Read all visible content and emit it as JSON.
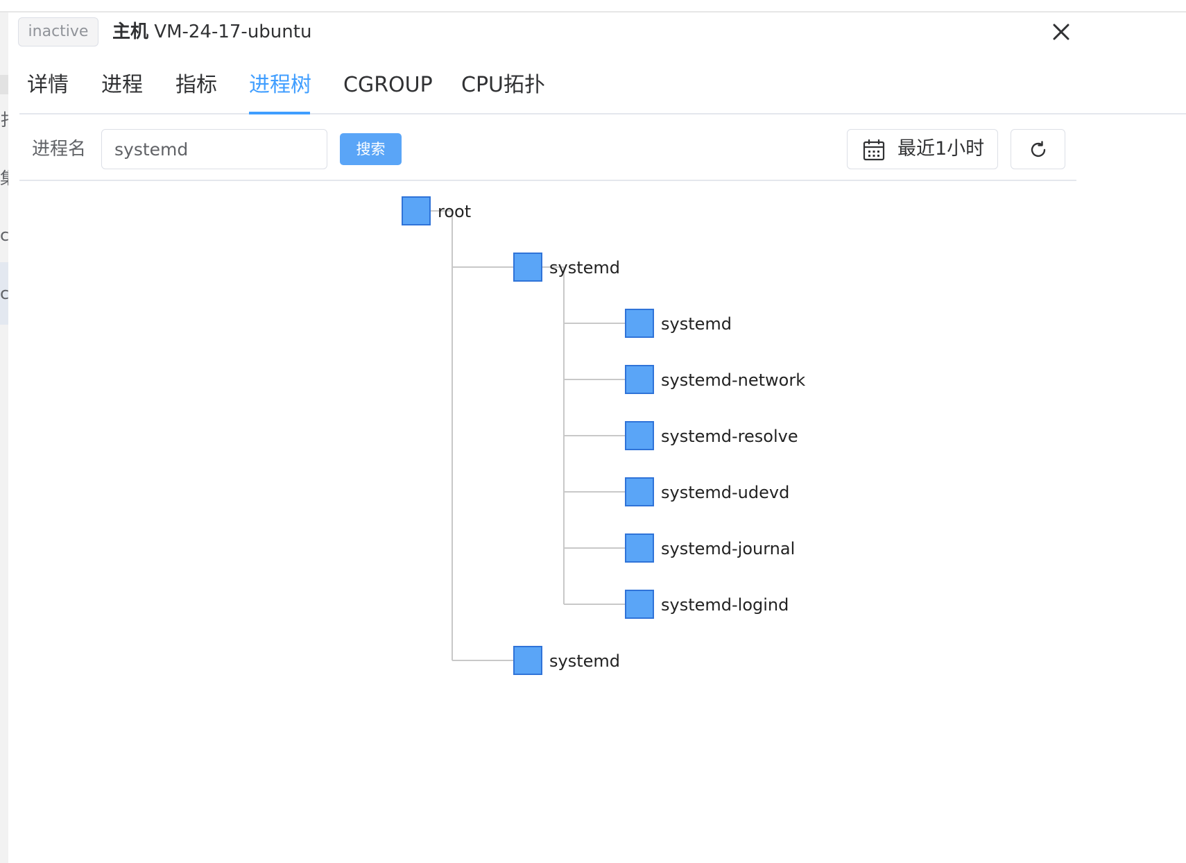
{
  "header": {
    "status": "inactive",
    "host_prefix": "主机",
    "host_name": "VM-24-17-ubuntu"
  },
  "tabs": [
    {
      "label": "详情",
      "active": false
    },
    {
      "label": "进程",
      "active": false
    },
    {
      "label": "指标",
      "active": false
    },
    {
      "label": "进程树",
      "active": true
    },
    {
      "label": "CGROUP",
      "active": false
    },
    {
      "label": "CPU拓扑",
      "active": false
    }
  ],
  "filter": {
    "label": "进程名",
    "input_value": "systemd",
    "search_label": "搜索",
    "time_range_label": "最近1小时"
  },
  "left_strip_fragments": [
    "扌",
    "集",
    "c",
    "c"
  ],
  "tree": {
    "label": "root",
    "children": [
      {
        "label": "systemd",
        "children": [
          {
            "label": "systemd"
          },
          {
            "label": "systemd-network"
          },
          {
            "label": "systemd-resolve"
          },
          {
            "label": "systemd-udevd"
          },
          {
            "label": "systemd-journal"
          },
          {
            "label": "systemd-logind"
          }
        ]
      },
      {
        "label": "systemd"
      }
    ]
  },
  "colors": {
    "accent": "#409eff",
    "node_fill": "#5aa5f7",
    "node_stroke": "#2f73d8",
    "link": "#c8c8c8"
  },
  "icons": {
    "close": "close-icon",
    "calendar": "calendar-icon",
    "refresh": "refresh-icon",
    "node": "square-node-icon"
  }
}
